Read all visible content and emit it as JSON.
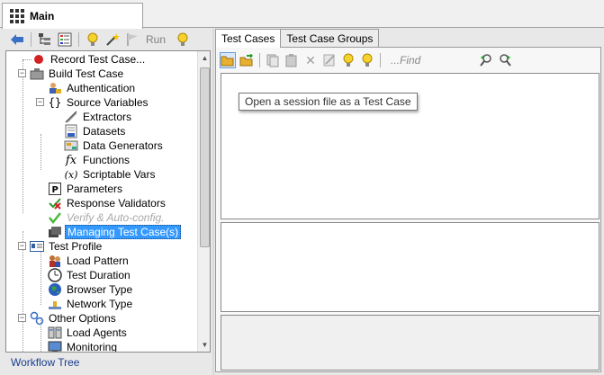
{
  "main_tab": {
    "label": "Main"
  },
  "left_toolbar": {
    "run_label": "Run"
  },
  "tree": {
    "items": [
      {
        "label": "Record Test Case...",
        "icon": "record-icon"
      },
      {
        "label": "Build Test Case",
        "icon": "build-icon"
      },
      {
        "label": "Authentication",
        "icon": "authentication-icon"
      },
      {
        "label": "Source Variables",
        "icon": "braces-icon"
      },
      {
        "label": "Extractors",
        "icon": "extractor-icon"
      },
      {
        "label": "Datasets",
        "icon": "dataset-icon"
      },
      {
        "label": "Data Generators",
        "icon": "data-generator-icon"
      },
      {
        "label": "Functions",
        "icon": "function-icon"
      },
      {
        "label": "Scriptable Vars",
        "icon": "scriptable-vars-icon"
      },
      {
        "label": "Parameters",
        "icon": "parameters-icon"
      },
      {
        "label": "Response Validators",
        "icon": "validator-icon"
      },
      {
        "label": "Verify & Auto-config.",
        "icon": "checkmark-icon"
      },
      {
        "label": "Managing Test Case(s)",
        "icon": "manage-icon"
      },
      {
        "label": "Test Profile",
        "icon": "profile-icon"
      },
      {
        "label": "Load Pattern",
        "icon": "users-icon"
      },
      {
        "label": "Test Duration",
        "icon": "clock-icon"
      },
      {
        "label": "Browser Type",
        "icon": "globe-icon"
      },
      {
        "label": "Network Type",
        "icon": "network-icon"
      },
      {
        "label": "Other Options",
        "icon": "options-icon"
      },
      {
        "label": "Load Agents",
        "icon": "agents-icon"
      },
      {
        "label": "Monitoring",
        "icon": "monitoring-icon"
      }
    ]
  },
  "workflow_label": "Workflow Tree",
  "right_tabs": [
    {
      "label": "Test Cases"
    },
    {
      "label": "Test Case Groups"
    }
  ],
  "right_toolbar": {
    "find_placeholder": "...Find"
  },
  "tooltip": {
    "text": "Open a session file as a Test Case"
  }
}
